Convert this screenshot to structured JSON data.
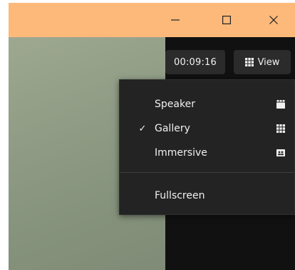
{
  "window_controls": {
    "minimize_icon": "minimize-icon",
    "maximize_icon": "maximize-icon",
    "close_icon": "close-icon"
  },
  "toolbar": {
    "timer": "00:09:16",
    "view_label": "View",
    "view_icon": "grid-icon"
  },
  "view_menu": {
    "items": [
      {
        "label": "Speaker",
        "checked": false,
        "icon": "speaker-view-icon"
      },
      {
        "label": "Gallery",
        "checked": true,
        "check_mark": "✓",
        "icon": "gallery-view-icon"
      },
      {
        "label": "Immersive",
        "checked": false,
        "icon": "immersive-view-icon"
      }
    ],
    "fullscreen_label": "Fullscreen"
  },
  "colors": {
    "titlebar": "#fdb97a",
    "menu_background": "#232323",
    "button_background": "#2b2b2b",
    "text": "#f0f0f0"
  }
}
